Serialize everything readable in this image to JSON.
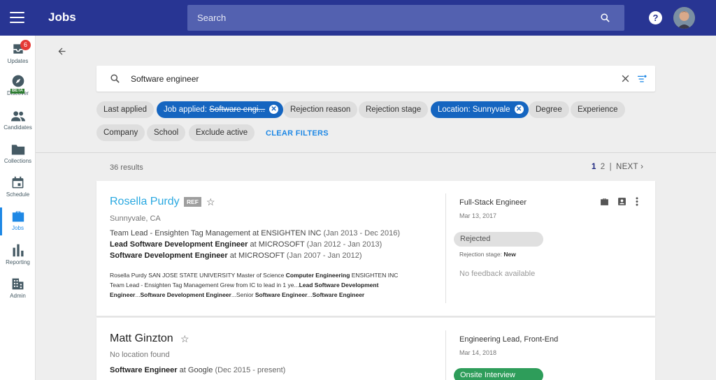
{
  "header": {
    "title": "Jobs",
    "search_placeholder": "Search",
    "help_label": "?"
  },
  "sidebar": {
    "items": [
      {
        "label": "Updates",
        "icon": "inbox-icon",
        "badge": "6"
      },
      {
        "label": "Discover",
        "icon": "compass-icon",
        "tag": "BETA"
      },
      {
        "label": "Candidates",
        "icon": "people-icon"
      },
      {
        "label": "Collections",
        "icon": "folder-icon"
      },
      {
        "label": "Schedule",
        "icon": "calendar-icon"
      },
      {
        "label": "Jobs",
        "icon": "briefcase-icon",
        "active": true
      },
      {
        "label": "Reporting",
        "icon": "bar-chart-icon"
      },
      {
        "label": "Admin",
        "icon": "building-icon"
      }
    ]
  },
  "filters": {
    "query": "Software engineer",
    "chips": [
      {
        "label": "Last applied"
      },
      {
        "label_prefix": "Job applied: ",
        "label_struck": "Software engi...",
        "selected": true
      },
      {
        "label": "Rejection reason"
      },
      {
        "label": "Rejection stage"
      },
      {
        "label": "Location: Sunnyvale",
        "selected": true
      },
      {
        "label": "Degree"
      },
      {
        "label": "Experience"
      },
      {
        "label": "Company"
      },
      {
        "label": "School"
      },
      {
        "label": "Exclude active"
      }
    ],
    "clear_label": "CLEAR FILTERS"
  },
  "results": {
    "count_label": "36 results",
    "pages": [
      "1",
      "2"
    ],
    "current_page": "1",
    "next_label": "NEXT"
  },
  "candidates": [
    {
      "name": "Rosella Purdy",
      "ref_tag": "REF",
      "location": "Sunnyvale, CA",
      "experience": [
        {
          "title": "Team Lead - Ensighten Tag Management",
          "at": "at",
          "company": "ENSIGHTEN INC",
          "dates": "(Jan 2013 - Dec 2016)"
        },
        {
          "title": "Lead Software Development Engineer",
          "at": "at",
          "company": "MICROSOFT",
          "dates": "(Jan 2012 - Jan 2013)"
        },
        {
          "title": "Software Development Engineer",
          "at": "at",
          "company": "MICROSOFT",
          "dates": "(Jan 2007 - Jan 2012)"
        }
      ],
      "snippet": {
        "l1a": "Rosella Purdy SAN JOSE STATE UNIVERSITY Master of Science ",
        "l1b": "Computer Engineering",
        "l1c": " ENSIGHTEN INC",
        "l2a": "Team Lead - Ensighten Tag Management Grew from IC to lead in 1 ye...",
        "l2b": "Lead Software Development",
        "l3a": "Engineer",
        "l3b": "...",
        "l3c": "Software Development Engineer",
        "l3d": "...Senior ",
        "l3e": "Software Engineer",
        "l3f": "...",
        "l3g": "Software Engineer"
      },
      "job_title": "Full-Stack Engineer",
      "job_date": "Mar 13, 2017",
      "status": "Rejected",
      "rejection_stage_label": "Rejection stage: ",
      "rejection_stage": "New",
      "feedback": "No feedback available"
    },
    {
      "name": "Matt Ginzton",
      "location": "No location found",
      "experience": [
        {
          "title": "Software Engineer",
          "at": "at",
          "company": "Google",
          "dates": "(Dec 2015 - present)"
        }
      ],
      "job_title": "Engineering Lead, Front-End",
      "job_date": "Mar 14, 2018",
      "status": "Onsite Interview"
    }
  ],
  "colors": {
    "topbar": "#283593",
    "accent": "#1e88e5",
    "selected_chip": "#1565c0",
    "link": "#29a8e0",
    "badge": "#e53935",
    "onsite": "#2e9d5a"
  }
}
